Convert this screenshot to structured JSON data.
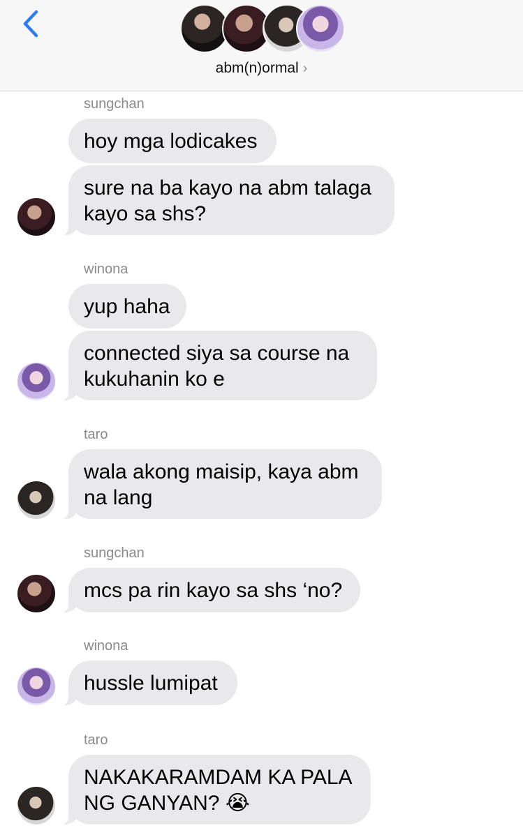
{
  "header": {
    "back_icon": "chevron-left-icon",
    "group_name": "abm(n)ormal",
    "chevron": "›",
    "accent_color": "#2f7bf6",
    "avatars": [
      "sungchan",
      "sungchan",
      "taro",
      "winona"
    ]
  },
  "messages": [
    {
      "sender": "sungchan",
      "bubbles": [
        "hoy mga lodicakes",
        [
          "sure na ba kayo na abm talaga",
          "kayo sa shs?"
        ]
      ]
    },
    {
      "sender": "winona",
      "bubbles": [
        "yup haha",
        [
          "connected siya sa course na",
          "kukuhanin ko e"
        ]
      ]
    },
    {
      "sender": "taro",
      "bubbles": [
        [
          "wala akong maisip, kaya abm",
          "na lang"
        ]
      ]
    },
    {
      "sender": "sungchan",
      "bubbles": [
        "mcs pa rin kayo sa shs ‘no?"
      ]
    },
    {
      "sender": "winona",
      "bubbles": [
        "hussle lumipat"
      ]
    },
    {
      "sender": "taro",
      "bubbles": [
        [
          "NAKAKARAMDAM KA PALA",
          "NG GANYAN? 😭"
        ]
      ]
    }
  ],
  "text": {
    "s1_name": "sungchan",
    "s1_b1": "hoy mga lodicakes",
    "s1_b2_l1": "sure na ba kayo na abm talaga",
    "s1_b2_l2": "kayo sa shs?",
    "s2_name": "winona",
    "s2_b1": "yup haha",
    "s2_b2_l1": "connected siya sa course na",
    "s2_b2_l2": "kukuhanin ko e",
    "s3_name": "taro",
    "s3_b1_l1": "wala akong maisip, kaya abm",
    "s3_b1_l2": "na lang",
    "s4_name": "sungchan",
    "s4_b1": "mcs pa rin kayo sa shs ‘no?",
    "s5_name": "winona",
    "s5_b1": "hussle lumipat",
    "s6_name": "taro",
    "s6_b1_l1": "NAKAKARAMDAM KA PALA",
    "s6_b1_l2": "NG GANYAN? 😭"
  }
}
